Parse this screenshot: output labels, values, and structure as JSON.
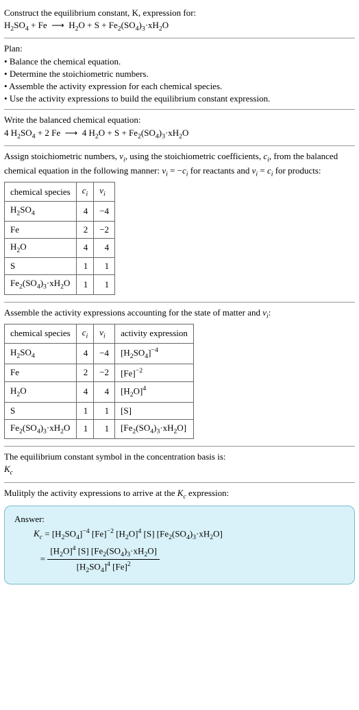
{
  "problem": {
    "heading": "Construct the equilibrium constant, K, expression for:",
    "equation": "H₂SO₄ + Fe ⟶ H₂O + S + Fe₂(SO₄)₃·xH₂O"
  },
  "plan": {
    "heading": "Plan:",
    "bullets": [
      "Balance the chemical equation.",
      "Determine the stoichiometric numbers.",
      "Assemble the activity expression for each chemical species.",
      "Use the activity expressions to build the equilibrium constant expression."
    ]
  },
  "balanced": {
    "heading": "Write the balanced chemical equation:",
    "equation": "4 H₂SO₄ + 2 Fe ⟶ 4 H₂O + S + Fe₂(SO₄)₃·xH₂O"
  },
  "stoich": {
    "heading_a": "Assign stoichiometric numbers, ",
    "heading_b": ", using the stoichiometric coefficients, ",
    "heading_c": ", from the balanced chemical equation in the following manner: ",
    "heading_d": " for reactants and ",
    "heading_e": " for products:",
    "nu_i": "νᵢ",
    "c_i": "cᵢ",
    "rel_react": "νᵢ = −cᵢ",
    "rel_prod": "νᵢ = cᵢ",
    "col_species": "chemical species",
    "col_c": "cᵢ",
    "col_nu": "νᵢ",
    "rows": [
      {
        "sp": "H₂SO₄",
        "c": "4",
        "nu": "−4"
      },
      {
        "sp": "Fe",
        "c": "2",
        "nu": "−2"
      },
      {
        "sp": "H₂O",
        "c": "4",
        "nu": "4"
      },
      {
        "sp": "S",
        "c": "1",
        "nu": "1"
      },
      {
        "sp": "Fe₂(SO₄)₃·xH₂O",
        "c": "1",
        "nu": "1"
      }
    ]
  },
  "activity": {
    "heading": "Assemble the activity expressions accounting for the state of matter and νᵢ:",
    "col_species": "chemical species",
    "col_c": "cᵢ",
    "col_nu": "νᵢ",
    "col_act": "activity expression",
    "rows": [
      {
        "sp": "H₂SO₄",
        "c": "4",
        "nu": "−4",
        "act": "[H₂SO₄]⁻⁴"
      },
      {
        "sp": "Fe",
        "c": "2",
        "nu": "−2",
        "act": "[Fe]⁻²"
      },
      {
        "sp": "H₂O",
        "c": "4",
        "nu": "4",
        "act": "[H₂O]⁴"
      },
      {
        "sp": "S",
        "c": "1",
        "nu": "1",
        "act": "[S]"
      },
      {
        "sp": "Fe₂(SO₄)₃·xH₂O",
        "c": "1",
        "nu": "1",
        "act": "[Fe₂(SO₄)₃·xH₂O]"
      }
    ]
  },
  "symbol": {
    "heading": "The equilibrium constant symbol in the concentration basis is:",
    "value": "K_c"
  },
  "multiply": {
    "heading": "Mulitply the activity expressions to arrive at the K_c expression:"
  },
  "answer": {
    "label": "Answer:",
    "line1_lhs": "K_c =",
    "line1_rhs": "[H₂SO₄]⁻⁴ [Fe]⁻² [H₂O]⁴ [S] [Fe₂(SO₄)₃·xH₂O]",
    "eq": "=",
    "frac_num": "[H₂O]⁴ [S] [Fe₂(SO₄)₃·xH₂O]",
    "frac_den": "[H₂SO₄]⁴ [Fe]²"
  },
  "chart_data": {
    "type": "table",
    "tables": [
      {
        "title": "Stoichiometric numbers",
        "columns": [
          "chemical species",
          "c_i",
          "nu_i"
        ],
        "rows": [
          [
            "H2SO4",
            4,
            -4
          ],
          [
            "Fe",
            2,
            -2
          ],
          [
            "H2O",
            4,
            4
          ],
          [
            "S",
            1,
            1
          ],
          [
            "Fe2(SO4)3·xH2O",
            1,
            1
          ]
        ]
      },
      {
        "title": "Activity expressions",
        "columns": [
          "chemical species",
          "c_i",
          "nu_i",
          "activity expression"
        ],
        "rows": [
          [
            "H2SO4",
            4,
            -4,
            "[H2SO4]^-4"
          ],
          [
            "Fe",
            2,
            -2,
            "[Fe]^-2"
          ],
          [
            "H2O",
            4,
            4,
            "[H2O]^4"
          ],
          [
            "S",
            1,
            1,
            "[S]"
          ],
          [
            "Fe2(SO4)3·xH2O",
            1,
            1,
            "[Fe2(SO4)3·xH2O]"
          ]
        ]
      }
    ]
  }
}
